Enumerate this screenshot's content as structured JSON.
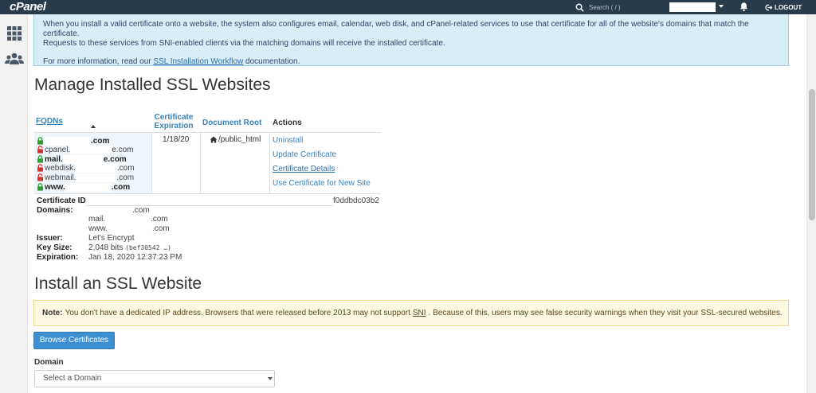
{
  "header": {
    "logo": "cPanel",
    "search_placeholder": "Search ( / )",
    "logout_label": "LOGOUT"
  },
  "info": {
    "line1": "When you install a valid certificate onto a website, the system also configures email, calendar, web disk, and cPanel-related services to use that certificate for all of the website's domains that match the certificate.",
    "line2": "Requests to these services from SNI-enabled clients via the matching domains will receive the installed certificate.",
    "more_prefix": "For more information, read our",
    "more_link": "SSL Installation Workflow",
    "more_suffix": "documentation."
  },
  "manage": {
    "title": "Manage Installed SSL Websites",
    "columns": {
      "fqdns": "FQDNs",
      "cert_expiration": "Certificate Expiration",
      "document_root": "Document Root",
      "actions": "Actions"
    },
    "fqdns": [
      {
        "prefix": "",
        "suffix": ".com",
        "secure": true
      },
      {
        "prefix": "cpanel.",
        "suffix": "e.com",
        "secure": false
      },
      {
        "prefix": "mail.",
        "suffix": "e.com",
        "secure": true
      },
      {
        "prefix": "webdisk.",
        "suffix": ".com",
        "secure": false
      },
      {
        "prefix": "webmail.",
        "suffix": ".com",
        "secure": false
      },
      {
        "prefix": "www.",
        "suffix": ".com",
        "secure": true
      }
    ],
    "expiration": "1/18/20",
    "document_root": "/public_html",
    "actions": {
      "uninstall": "Uninstall",
      "update": "Update Certificate",
      "details": "Certificate Details",
      "use_new": "Use Certificate for New Site"
    },
    "details": {
      "cert_id_label": "Certificate ID:",
      "cert_id_tail": "f0ddbdc03b2",
      "domains_label": "Domains:",
      "domains": [
        ".com",
        "mail.",
        ".com",
        "www.",
        ".com"
      ],
      "issuer_label": "Issuer:",
      "issuer": "Let's Encrypt",
      "keysize_label": "Key Size:",
      "keysize": "2,048 bits",
      "keysize_mod": "(bef30542 …)",
      "expiration_label": "Expiration:",
      "expiration": "Jan 18, 2020 12:37:23 PM"
    }
  },
  "install": {
    "title": "Install an SSL Website",
    "note_label": "Note:",
    "note_text_1": "You don't have a dedicated IP address. Browsers that were released before 2013 may not support",
    "note_sni": "SNI",
    "note_text_2": ". Because of this, users may see false security warnings when they visit your SSL-secured websites.",
    "browse_button": "Browse Certificates",
    "domain_label": "Domain",
    "domain_placeholder": "Select a Domain"
  },
  "colors": {
    "topbar": "#293a4a",
    "link": "#3b82b9",
    "lock_secure": "#2e9e33",
    "lock_insecure": "#d9312b",
    "button": "#3d8fd1"
  }
}
